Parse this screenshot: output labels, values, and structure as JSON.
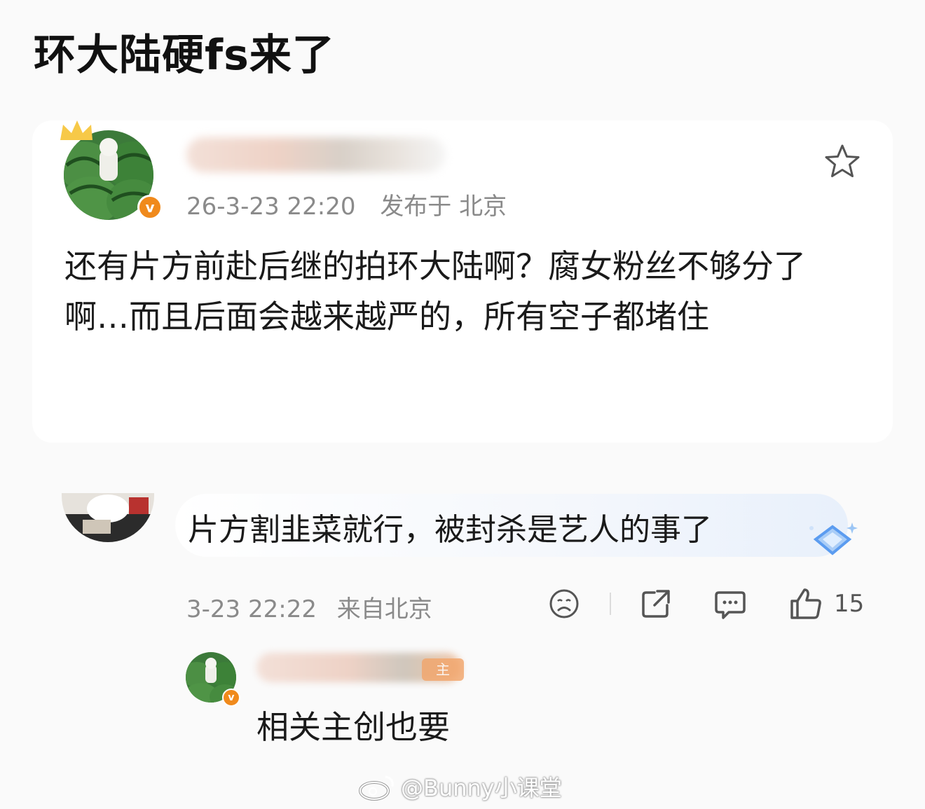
{
  "headline": "环大陆硬fs来了",
  "post": {
    "author_name": "",
    "timestamp": "26-3-23 22:20",
    "location": "发布于 北京",
    "text": "还有片方前赴后继的拍环大陆啊？腐女粉丝不够分了啊…而且后面会越来越严的，所有空子都堵住",
    "icons": {
      "favorite": "star-outline-icon",
      "verified": "verified-v-badge-icon",
      "crown": "crown-icon"
    }
  },
  "comment": {
    "text": "片方割韭菜就行，被封杀是艺人的事了",
    "timestamp": "3-23 22:22",
    "source": "来自北京",
    "like_count": "15",
    "actions": [
      "sad-face-icon",
      "share-icon",
      "comment-bubble-icon",
      "thumbs-up-icon"
    ]
  },
  "reply": {
    "badge": "主",
    "text": "相关主创也要"
  },
  "watermark": {
    "text": "@Bunny小课堂",
    "icon": "weibo-logo-icon"
  },
  "colors": {
    "verified": "#f08a1c",
    "crown": "#f7c948",
    "meta_text": "#8a8a8a",
    "gem": "#5b9cf0"
  }
}
